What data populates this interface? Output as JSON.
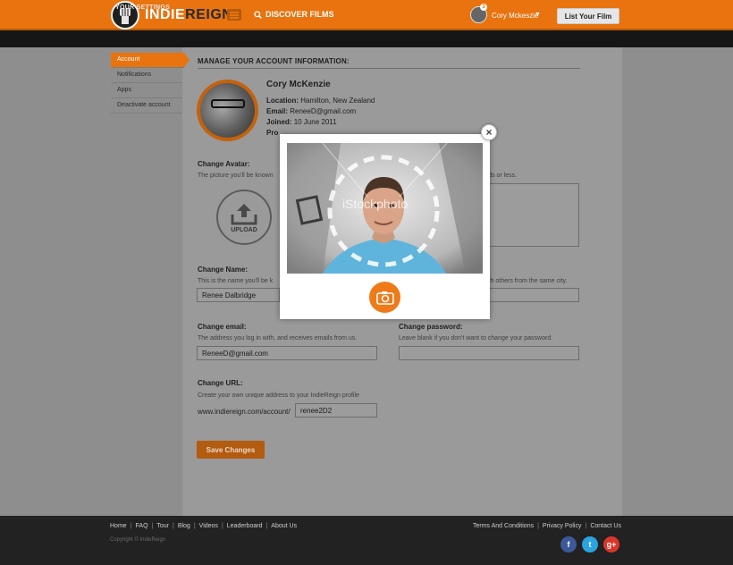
{
  "header": {
    "logo_left": "INDIE",
    "logo_right": "REIGN",
    "discover_label": "DISCOVER FILMS",
    "user_name": "Cory Mckeszie",
    "notification_count": "3",
    "list_film_label": "List Your Film"
  },
  "subheader": {
    "title": "YOUR SETTINGS"
  },
  "sidebar": {
    "items": [
      {
        "label": "Account",
        "active": true
      },
      {
        "label": "Notifications",
        "active": false
      },
      {
        "label": "Apps",
        "active": false
      },
      {
        "label": "Deactivate account",
        "active": false
      }
    ]
  },
  "main": {
    "section_title": "MANAGE YOUR ACCOUNT INFORMATION:",
    "profile": {
      "name": "Cory McKenzie",
      "location_label": "Location:",
      "location": "Hamilton, New Zealand",
      "email_label": "Email:",
      "email": "ReneeD@gmail.com",
      "joined_label": "Joined:",
      "joined": "10 June 2011",
      "profile_label": "Pro"
    },
    "avatar": {
      "label": "Change Avatar:",
      "help": "The picture you'll be known",
      "upload_label": "UPLOAD",
      "bio_help": "ords or less."
    },
    "name": {
      "label": "Change Name:",
      "help": "This is the name you'll be k",
      "value": "Renee Dalbridge",
      "right_help": "with others from the same city."
    },
    "email": {
      "label": "Change email:",
      "help": "The address you log in with, and receives emails from us.",
      "value": "ReneeD@gmail.com"
    },
    "password": {
      "label": "Change password:",
      "help": "Leave blank if you don't want to change your password.",
      "value": ""
    },
    "url": {
      "label": "Change URL:",
      "help": "Create your own unique address to your IndieReign profile",
      "prefix": "www.indiereign.com/account/",
      "value": "renee2D2"
    },
    "save_label": "Save Changes"
  },
  "modal": {
    "close_glyph": "×",
    "watermark": "iStockphoto"
  },
  "footer": {
    "left_links": [
      "Home",
      "FAQ",
      "Tour",
      "Blog",
      "Videos",
      "Leaderboard",
      "About Us"
    ],
    "right_links": [
      "Terms And Conditions",
      "Privacy Policy",
      "Contact Us"
    ],
    "copyright": "Copyright © IndieReign",
    "social": [
      {
        "name": "facebook",
        "glyph": "f",
        "color": "#3b5998"
      },
      {
        "name": "twitter",
        "glyph": "t",
        "color": "#2aa3e0"
      },
      {
        "name": "googleplus",
        "glyph": "g+",
        "color": "#d9362b"
      }
    ]
  },
  "colors": {
    "brand_orange": "#e8730f",
    "dark": "#161616"
  }
}
